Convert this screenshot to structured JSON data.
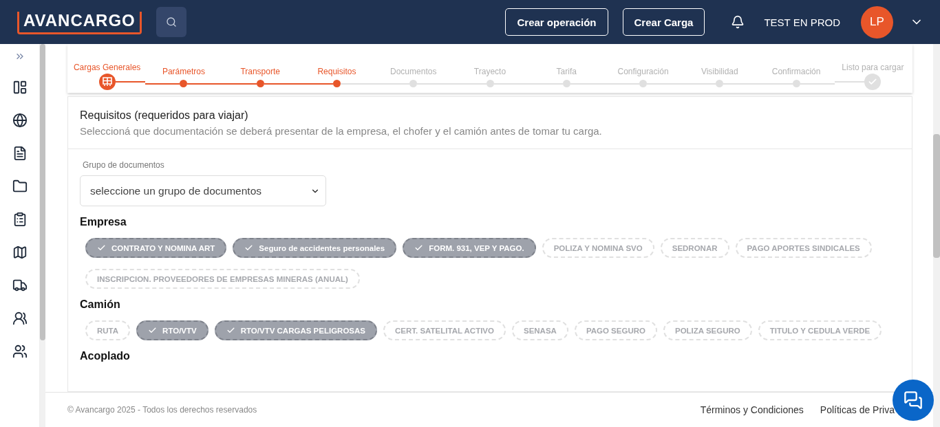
{
  "header": {
    "logo": "AVANCARGO",
    "buttons": [
      "Crear operación",
      "Crear Carga"
    ],
    "user": "TEST EN PROD",
    "avatar": "LP"
  },
  "stepper": [
    {
      "label": "Cargas Generales",
      "done": true,
      "kind": "start"
    },
    {
      "label": "Parámetros",
      "done": true,
      "kind": "dot"
    },
    {
      "label": "Transporte",
      "done": true,
      "kind": "dot"
    },
    {
      "label": "Requisitos",
      "done": true,
      "kind": "dot"
    },
    {
      "label": "Documentos",
      "done": false,
      "kind": "dot"
    },
    {
      "label": "Trayecto",
      "done": false,
      "kind": "dot"
    },
    {
      "label": "Tarifa",
      "done": false,
      "kind": "dot"
    },
    {
      "label": "Configuración",
      "done": false,
      "kind": "dot"
    },
    {
      "label": "Visibilidad",
      "done": false,
      "kind": "dot"
    },
    {
      "label": "Confirmación",
      "done": false,
      "kind": "dot"
    },
    {
      "label": "Listo para cargar",
      "done": false,
      "kind": "end"
    }
  ],
  "section": {
    "title": "Requisitos (requeridos para viajar)",
    "subtitle": "Seleccioná que documentación se deberá presentar de la empresa, el chofer y el camión antes de tomar tu carga."
  },
  "document_group": {
    "label": "Grupo de documentos",
    "value": "seleccione un grupo de documentos"
  },
  "groups": [
    {
      "title": "Empresa",
      "chips": [
        {
          "label": "CONTRATO Y NOMINA ART",
          "selected": true
        },
        {
          "label": "Seguro de accidentes personales",
          "selected": true
        },
        {
          "label": "FORM. 931, VEP Y PAGO.",
          "selected": true
        },
        {
          "label": "POLIZA Y NOMINA SVO",
          "selected": false
        },
        {
          "label": "SEDRONAR",
          "selected": false
        },
        {
          "label": "PAGO APORTES SINDICALES",
          "selected": false
        },
        {
          "label": "INSCRIPCION. PROVEEDORES DE EMPRESAS MINERAS (ANUAL)",
          "selected": false
        }
      ]
    },
    {
      "title": "Camión",
      "chips": [
        {
          "label": "RUTA",
          "selected": false
        },
        {
          "label": "RTO/VTV",
          "selected": true
        },
        {
          "label": "RTO/VTV CARGAS PELIGROSAS",
          "selected": true
        },
        {
          "label": "CERT. SATELITAL ACTIVO",
          "selected": false
        },
        {
          "label": "SENASA",
          "selected": false
        },
        {
          "label": "PAGO SEGURO",
          "selected": false
        },
        {
          "label": "POLIZA SEGURO",
          "selected": false
        },
        {
          "label": "TITULO Y CEDULA VERDE",
          "selected": false
        }
      ]
    },
    {
      "title": "Acoplado"
    }
  ],
  "footer": {
    "copyright": "© Avancargo 2025 - Todos los derechos reservados",
    "links": [
      "Términos y Condiciones",
      "Políticas de Priva"
    ]
  }
}
